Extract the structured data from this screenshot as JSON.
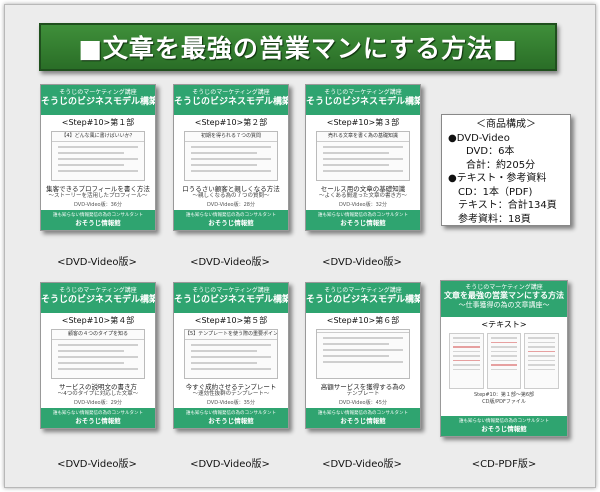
{
  "banner": {
    "title": "■文章を最強の営業マンにする方法■"
  },
  "cards": [
    {
      "series": "そうじのマーケティング講座",
      "course": "そうじのビジネスモデル構築法",
      "step": "<Step#10>第１部",
      "preview_header": "【4】どんな風に書けばいいか？",
      "title": "集客できるプロフィールを書く方法",
      "subtitle": "～ストーリーを活用したプロフィール～",
      "duration": "DVD-Video版：36分",
      "footer_small": "誰も知らない情報発信の為のコンサルタント",
      "footer_name": "おそうじ情報館",
      "label": "<DVD-Video版>"
    },
    {
      "series": "そうじのマーケティング講座",
      "course": "そうじのビジネスモデル構築法",
      "step": "<Step#10>第２部",
      "preview_header": "初期を得られる７つの質問",
      "title": "口うるさい顧客と親しくなる方法",
      "subtitle": "～親しくなる為の７つの質問～",
      "duration": "DVD-Video版：28分",
      "footer_small": "誰も知らない情報発信の為のコンサルタント",
      "footer_name": "おそうじ情報館",
      "label": "<DVD-Video版>"
    },
    {
      "series": "そうじのマーケティング講座",
      "course": "そうじのビジネスモデル構築法",
      "step": "<Step#10>第３部",
      "preview_header": "売れる文章を書く為の基礎知識",
      "title": "セールス用の文章の基礎知識",
      "subtitle": "～よくある間違った文章の書き方～",
      "duration": "DVD-Video版：32分",
      "footer_small": "誰も知らない情報発信の為のコンサルタント",
      "footer_name": "おそうじ情報館",
      "label": "<DVD-Video版>"
    },
    {
      "series": "そうじのマーケティング講座",
      "course": "そうじのビジネスモデル構築法",
      "step": "<Step#10>第４部",
      "preview_header": "顧客の４つのタイプを知る",
      "title": "サービスの説明文の書き方",
      "subtitle": "～4つのタイプに対応した文章～",
      "duration": "DVD-Video版：29分",
      "footer_small": "誰も知らない情報発信の為のコンサルタント",
      "footer_name": "おそうじ情報館",
      "label": "<DVD-Video版>"
    },
    {
      "series": "そうじのマーケティング講座",
      "course": "そうじのビジネスモデル構築法",
      "step": "<Step#10>第５部",
      "preview_header": "【5】テンプレートを使う際の重要ポイント",
      "title": "今すぐ成約させるテンプレート",
      "subtitle": "～速効性抜群のテンプレート～",
      "duration": "DVD-Video版：35分",
      "footer_small": "誰も知らない情報発信の為のコンサルタント",
      "footer_name": "おそうじ情報館",
      "label": "<DVD-Video版>"
    },
    {
      "series": "そうじのマーケティング講座",
      "course": "そうじのビジネスモデル構築法",
      "step": "<Step#10>第６部",
      "preview_header": "",
      "title": "高額サービスを獲得する為の",
      "subtitle": "テンプレート",
      "duration": "DVD-Video版：45分",
      "footer_small": "誰も知らない情報発信の為のコンサルタント",
      "footer_name": "おそうじ情報館",
      "label": "<DVD-Video版>"
    }
  ],
  "info_box": {
    "title": "＜商品構成＞",
    "line1": "●DVD-Video",
    "line2": "DVD：6本",
    "line3": "合計：約205分",
    "line4": "●テキスト・参考資料",
    "line5": "CD：1本（PDF)",
    "line6": "テキスト：合計134頁",
    "line7": "参考資料：18頁"
  },
  "text_card": {
    "series": "そうじのマーケティング講座",
    "title": "文章を最強の営業マンにする方法",
    "subtitle": "～仕事獲得の為の文章講座～",
    "keyword": "<テキスト>",
    "info1": "Step#10：第１部〜第6部",
    "info2": "CD版/PDFファイル",
    "footer_small": "誰も知らない情報発信の為のコンサルタント",
    "footer_name": "おそうじ情報館",
    "label": "<CD-PDF版>"
  },
  "colors": {
    "banner": "#2f7e2b",
    "card_accent": "#2fa470",
    "background": "#ececec"
  }
}
